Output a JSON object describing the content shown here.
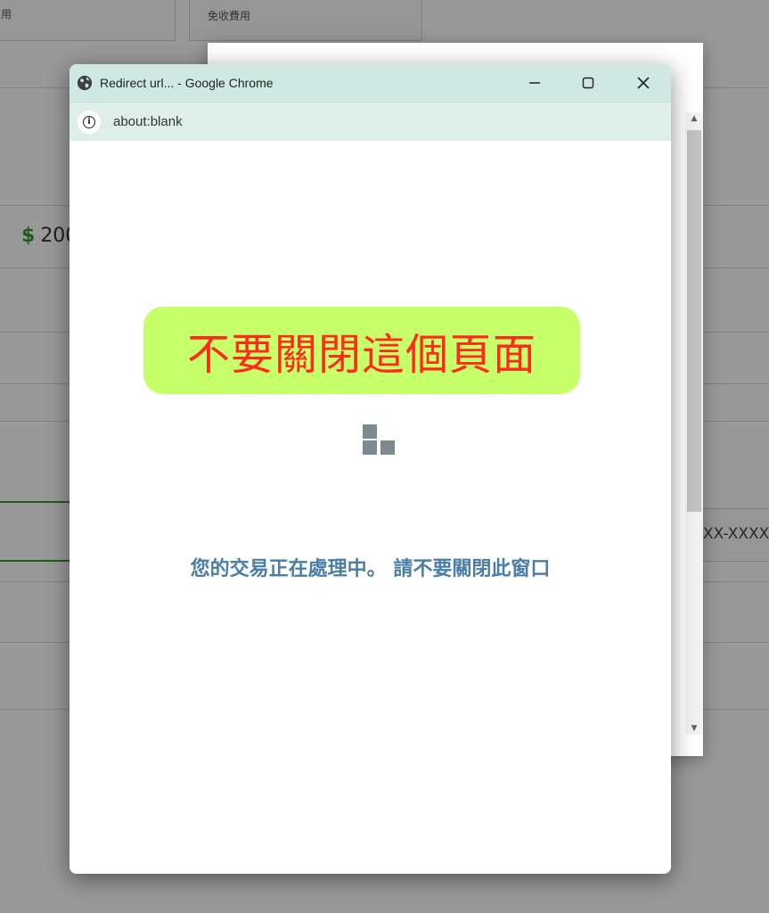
{
  "background_page": {
    "top_card_label_left": "用",
    "top_card_label_right": "免收費用",
    "price_currency": "$",
    "price_value": "200",
    "masked_input": "XX-XXXX"
  },
  "chrome_window": {
    "title": "Redirect url... - Google Chrome",
    "icons": {
      "site": "globe-icon",
      "minimize": "minimize-icon",
      "maximize": "maximize-icon",
      "close": "close-icon",
      "info": "info-icon"
    },
    "address": "about:blank"
  },
  "page": {
    "warning_banner": "不要關閉這個頁面",
    "status_message": "您的交易正在處理中。 請不要關閉此窗口",
    "colors": {
      "banner_bg": "#c6ff6a",
      "banner_text": "#ff2a1a",
      "status_text": "#4a7ea6",
      "titlebar_bg": "#cfe8e2"
    }
  }
}
